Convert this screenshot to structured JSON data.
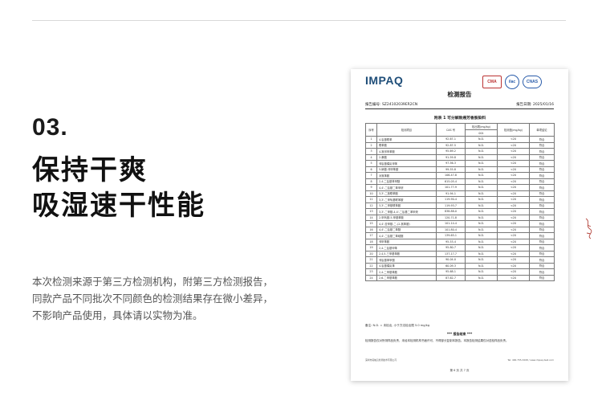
{
  "section_number": "03.",
  "headline": [
    "保持干爽",
    "吸湿速干性能"
  ],
  "description": [
    "本次检测来源于第三方检测机构，附第三方检测报告，",
    "同款产品不同批次不同颜色的检测结果存在微小差异，",
    "不影响产品使用，具体请以实物为准。"
  ],
  "report": {
    "brand": "IMPAQ",
    "certs": [
      "CMA",
      "ilac",
      "CNAS"
    ],
    "title": "检测报告",
    "report_no": "报告编号: SZ24102039ER2CN",
    "date": "报告日期: 2025/01/16",
    "table_title": "附表 1  可分解致癌芳香胺染料",
    "columns": [
      "序号",
      "检测项目",
      "CAS 号",
      "检出限(mg/kg)",
      "检测值(mg/kg)",
      "单项结论"
    ],
    "subheader": "001",
    "rows": [
      [
        "1",
        "4-氨基联苯",
        "92-67-1",
        "N.D.",
        "<20",
        "符合"
      ],
      [
        "2",
        "联苯胺",
        "92-87-5",
        "N.D.",
        "<20",
        "符合"
      ],
      [
        "3",
        "4-氯邻甲苯胺",
        "95-69-2",
        "N.D.",
        "<20",
        "符合"
      ],
      [
        "4",
        "2-萘胺",
        "91-59-8",
        "N.D.",
        "<20",
        "符合"
      ],
      [
        "5",
        "邻氨基偶氮甲苯",
        "97-56-3",
        "N.D.",
        "<20",
        "符合"
      ],
      [
        "6",
        "5-硝基-邻甲苯胺",
        "99-55-8",
        "N.D.",
        "<20",
        "符合"
      ],
      [
        "7",
        "对氯苯胺",
        "106-47-8",
        "N.D.",
        "<20",
        "符合"
      ],
      [
        "8",
        "2,4-二氨基苯甲醚",
        "615-05-4",
        "N.D.",
        "<20",
        "符合"
      ],
      [
        "9",
        "4,4'-二氨基二苯甲烷",
        "101-77-9",
        "N.D.",
        "<20",
        "符合"
      ],
      [
        "10",
        "3,3'-二氯联苯胺",
        "91-94-1",
        "N.D.",
        "<20",
        "符合"
      ],
      [
        "11",
        "3,3'-二甲氧基联苯胺",
        "119-90-4",
        "N.D.",
        "<20",
        "符合"
      ],
      [
        "12",
        "3,3'-二甲基联苯胺",
        "119-93-7",
        "N.D.",
        "<20",
        "符合"
      ],
      [
        "13",
        "3,3'-二甲基-4,4'-二氨基二苯甲烷",
        "838-88-0",
        "N.D.",
        "<20",
        "符合"
      ],
      [
        "14",
        "2-甲氧基-5-甲基苯胺",
        "120-71-8",
        "N.D.",
        "<20",
        "符合"
      ],
      [
        "15",
        "4,4'-亚甲基-二-(2-氯苯胺)",
        "101-14-4",
        "N.D.",
        "<20",
        "符合"
      ],
      [
        "16",
        "4,4'-二氨基二苯醚",
        "101-80-4",
        "N.D.",
        "<20",
        "符合"
      ],
      [
        "17",
        "4,4'-二氨基二苯硫醚",
        "139-65-1",
        "N.D.",
        "<20",
        "符合"
      ],
      [
        "18",
        "邻甲苯胺",
        "95-53-4",
        "N.D.",
        "<20",
        "符合"
      ],
      [
        "19",
        "2,4-二氨基甲苯",
        "95-80-7",
        "N.D.",
        "<20",
        "符合"
      ],
      [
        "20",
        "2,4,5-三甲基苯胺",
        "137-17-7",
        "N.D.",
        "<20",
        "符合"
      ],
      [
        "21",
        "邻氨基苯甲醚",
        "90-04-0",
        "N.D.",
        "<20",
        "符合"
      ],
      [
        "22",
        "4-氨基偶氮苯",
        "60-09-3",
        "N.D.",
        "<20",
        "符合"
      ],
      [
        "23",
        "2,4-二甲基苯胺",
        "95-68-1",
        "N.D.",
        "<20",
        "符合"
      ],
      [
        "24",
        "2,6-二甲基苯胺",
        "87-62-7",
        "N.D.",
        "<20",
        "符合"
      ]
    ],
    "note": "备注: N.D. = 未检出, 小于方法检出限 5.0 mg/kg",
    "end_mark": "*** 报告结束 ***",
    "statement": "检测报告仅对所测样品负责，未经本检测机构书面许可，不得部分复制本报告。本报告检测结果仅对送检样品负责。",
    "footer_left": "深圳市英帕克检测技术有限公司",
    "footer_right": "Tel: 400-755-3208 / www.impaq-test.com",
    "page": "第 6 页 共 7 页"
  }
}
